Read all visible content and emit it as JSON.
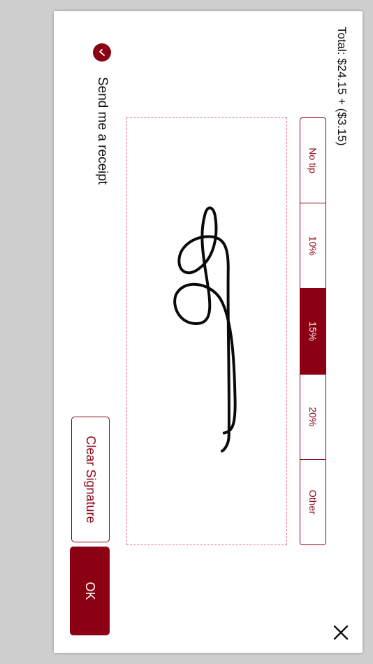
{
  "header": {
    "total_text": "Total: $24.15 + ($3.15)"
  },
  "tips": {
    "options": [
      {
        "label": "No tip",
        "selected": false
      },
      {
        "label": "10%",
        "selected": false
      },
      {
        "label": "15%",
        "selected": true
      },
      {
        "label": "20%",
        "selected": false
      },
      {
        "label": "Other",
        "selected": false
      }
    ]
  },
  "receipt": {
    "label": "Send me a receipt",
    "checked": true
  },
  "actions": {
    "clear_label": "Clear Signature",
    "ok_label": "OK"
  },
  "colors": {
    "accent": "#8b0012",
    "signature_border": "#e8739a",
    "background": "#cfcfcf",
    "card": "#ffffff"
  },
  "icons": {
    "close": "close-icon",
    "check": "check-icon"
  }
}
